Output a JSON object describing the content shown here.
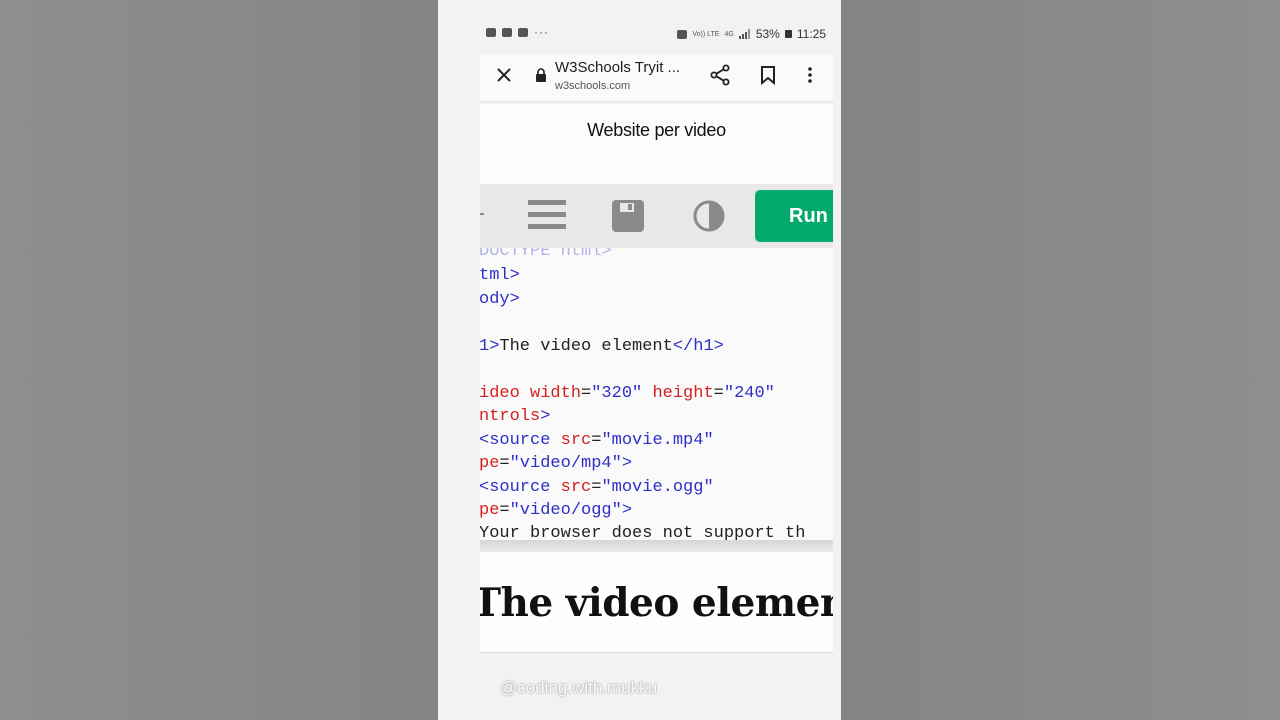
{
  "status_bar": {
    "battery": "53%",
    "time": "11:25",
    "network_label_1": "Vo)) LTE",
    "network_label_2": "4G",
    "more_dots": "···"
  },
  "browser": {
    "tab_title": "W3Schools Tryit ...",
    "url": "w3schools.com"
  },
  "site": {
    "title": "Website per video"
  },
  "toolbar": {
    "run_label": "Run"
  },
  "code_lines": [
    {
      "parts": [
        {
          "t": "tg",
          "s": "DOCTYPE html>"
        }
      ]
    },
    {
      "parts": [
        {
          "t": "tg",
          "s": "tml>"
        }
      ]
    },
    {
      "parts": [
        {
          "t": "tg",
          "s": "ody>"
        }
      ]
    },
    {
      "parts": [
        {
          "t": "tg",
          "s": "1>"
        },
        {
          "t": "tx",
          "s": "The video element"
        },
        {
          "t": "tg",
          "s": "</h1>"
        }
      ]
    },
    {
      "parts": [
        {
          "t": "at",
          "s": "ideo width"
        },
        {
          "t": "tx",
          "s": "="
        },
        {
          "t": "vl",
          "s": "\"320\""
        },
        {
          "t": "tx",
          "s": " "
        },
        {
          "t": "at",
          "s": "height"
        },
        {
          "t": "tx",
          "s": "="
        },
        {
          "t": "vl",
          "s": "\"240\""
        }
      ]
    },
    {
      "parts": [
        {
          "t": "at",
          "s": "ntrols"
        },
        {
          "t": "tg",
          "s": ">"
        }
      ]
    },
    {
      "parts": [
        {
          "t": "tg",
          "s": "<source "
        },
        {
          "t": "at",
          "s": "src"
        },
        {
          "t": "tx",
          "s": "="
        },
        {
          "t": "vl",
          "s": "\"movie.mp4\""
        }
      ]
    },
    {
      "parts": [
        {
          "t": "at",
          "s": "pe"
        },
        {
          "t": "tx",
          "s": "="
        },
        {
          "t": "vl",
          "s": "\"video/mp4\""
        },
        {
          "t": "tg",
          "s": ">"
        }
      ]
    },
    {
      "parts": [
        {
          "t": "tg",
          "s": "<source "
        },
        {
          "t": "at",
          "s": "src"
        },
        {
          "t": "tx",
          "s": "="
        },
        {
          "t": "vl",
          "s": "\"movie.ogg\""
        }
      ]
    },
    {
      "parts": [
        {
          "t": "at",
          "s": "pe"
        },
        {
          "t": "tx",
          "s": "="
        },
        {
          "t": "vl",
          "s": "\"video/ogg\""
        },
        {
          "t": "tg",
          "s": ">"
        }
      ]
    },
    {
      "parts": [
        {
          "t": "tx",
          "s": "Your browser does not support th"
        }
      ]
    }
  ],
  "result": {
    "heading": "The video element"
  },
  "watermark": "@coding.with.mukku"
}
